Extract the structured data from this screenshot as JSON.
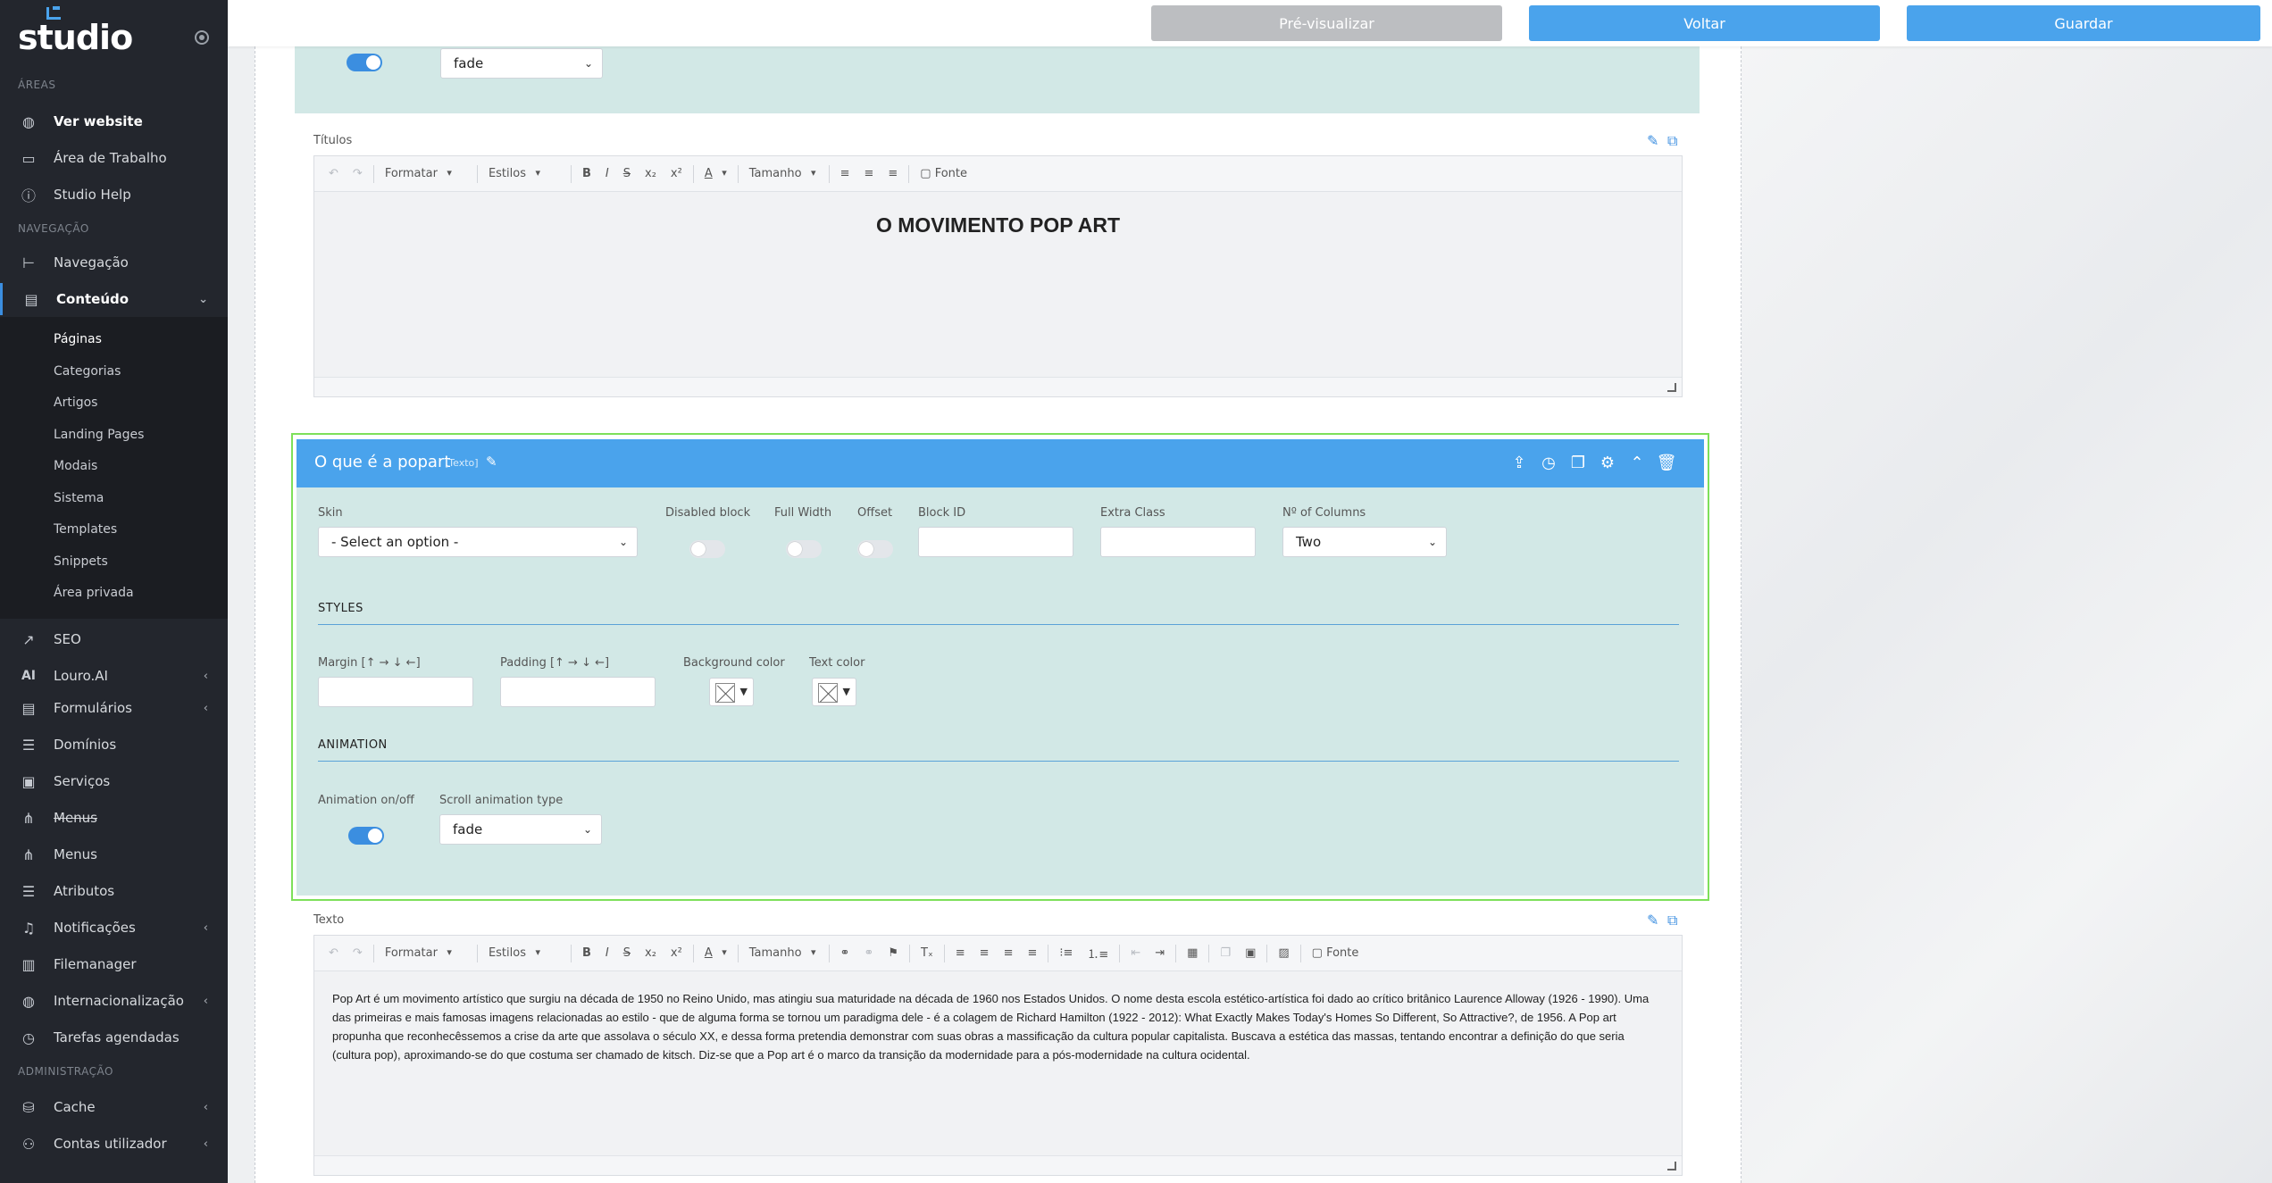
{
  "app": {
    "logo": "studio"
  },
  "sidebar": {
    "sections": {
      "areas": "ÁREAS",
      "navigation": "NAVEGAÇÃO",
      "admin": "ADMINISTRAÇÃO"
    },
    "items": [
      {
        "label": "Ver website",
        "icon": "globe-icon"
      },
      {
        "label": "Área de Trabalho",
        "icon": "monitor-icon"
      },
      {
        "label": "Studio Help",
        "icon": "info-icon"
      },
      {
        "label": "Navegação",
        "icon": "tree-icon"
      },
      {
        "label": "Conteúdo",
        "icon": "document-icon"
      },
      {
        "label": "SEO",
        "icon": "chart-line-icon"
      },
      {
        "label": "Louro.AI",
        "icon": "ai-icon"
      },
      {
        "label": "Formulários",
        "icon": "form-icon"
      },
      {
        "label": "Domínios",
        "icon": "list-icon"
      },
      {
        "label": "Serviços",
        "icon": "services-icon"
      },
      {
        "label": "Menus",
        "icon": "sitemap-icon"
      },
      {
        "label": "Menus",
        "icon": "sitemap-icon"
      },
      {
        "label": "Atributos",
        "icon": "list-icon"
      },
      {
        "label": "Notificações",
        "icon": "bell-icon"
      },
      {
        "label": "Filemanager",
        "icon": "archive-icon"
      },
      {
        "label": "Internacionalização",
        "icon": "globe-icon"
      },
      {
        "label": "Tarefas agendadas",
        "icon": "clock-icon"
      },
      {
        "label": "Cache",
        "icon": "database-icon"
      },
      {
        "label": "Contas utilizador",
        "icon": "users-icon"
      }
    ],
    "subitems": [
      "Páginas",
      "Categorias",
      "Artigos",
      "Landing Pages",
      "Modais",
      "Sistema",
      "Templates",
      "Snippets",
      "Área privada"
    ]
  },
  "topbar": {
    "preview": "Pré-visualizar",
    "back": "Voltar",
    "save": "Guardar"
  },
  "top_block": {
    "animation_value": "fade"
  },
  "titulos": {
    "label": "Títulos",
    "heading": "O MOVIMENTO POP ART"
  },
  "toolbar": {
    "format": "Formatar",
    "styles": "Estilos",
    "size": "Tamanho",
    "source": "Fonte",
    "bold": "B",
    "italic": "I",
    "strike": "S",
    "sub": "x₂",
    "sup": "x²",
    "color": "A"
  },
  "block": {
    "title": "O que é a popart",
    "type": "[Texto]",
    "fields": {
      "skin": "Skin",
      "skin_value": "- Select an option -",
      "disabled": "Disabled block",
      "full_width": "Full Width",
      "offset": "Offset",
      "block_id": "Block ID",
      "extra_class": "Extra Class",
      "columns": "Nº of Columns",
      "columns_value": "Two"
    },
    "styles_title": "STYLES",
    "styles": {
      "margin": "Margin [↑ → ↓ ←]",
      "padding": "Padding [↑ → ↓ ←]",
      "bg": "Background color",
      "text": "Text color"
    },
    "animation_title": "ANIMATION",
    "animation": {
      "onoff": "Animation on/off",
      "type": "Scroll animation type",
      "type_value": "fade"
    }
  },
  "texto": {
    "label": "Texto",
    "body": "Pop Art é um movimento artístico que surgiu na década de 1950 no Reino Unido, mas atingiu sua maturidade na década de 1960 nos Estados Unidos. O nome desta escola estético-artística foi dado ao crítico britânico Laurence Alloway (1926 - 1990). Uma das primeiras e mais famosas imagens relacionadas ao estilo - que de alguma forma se tornou um paradigma dele - é a colagem de Richard Hamilton (1922 - 2012): What Exactly Makes Today's Homes So Different, So Attractive?, de 1956. A Pop art propunha que reconhecêssemos a crise da arte que assolava o século XX, e dessa forma pretendia demonstrar com suas obras a massificação da cultura popular capitalista. Buscava a estética das massas, tentando encontrar a definição do que seria (cultura pop), aproximando-se do que costuma ser chamado de kitsch. Diz-se que a Pop art é o marco da transição da modernidade para a pós-modernidade na cultura ocidental."
  }
}
